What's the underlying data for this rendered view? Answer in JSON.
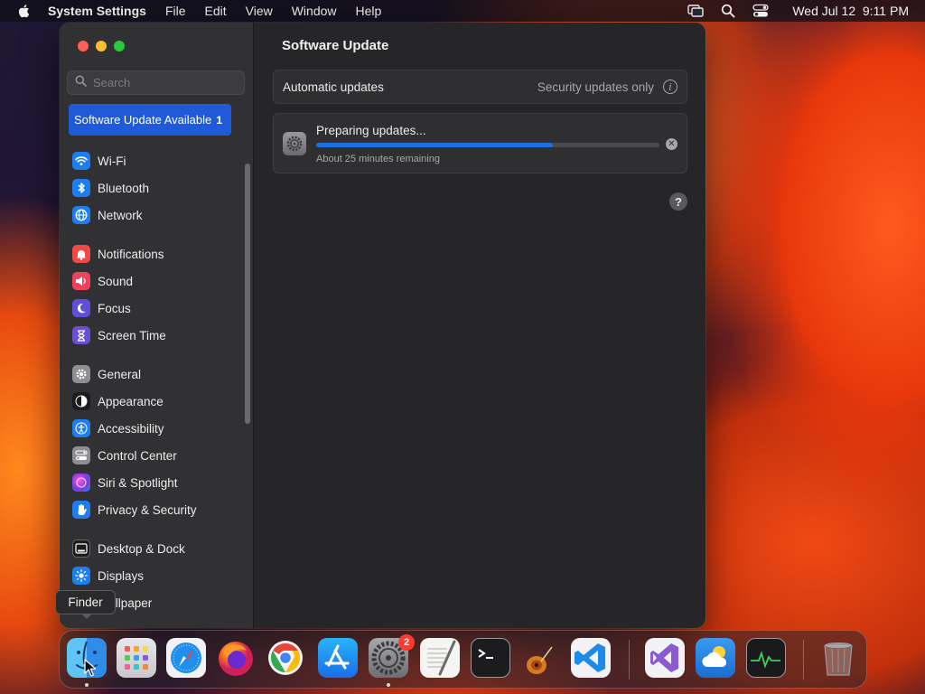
{
  "menubar": {
    "apple_icon": "apple-logo-icon",
    "app_name": "System Settings",
    "menus": [
      "File",
      "Edit",
      "View",
      "Window",
      "Help"
    ],
    "status_icons": [
      "screen-mirroring-icon",
      "spotlight-search-icon",
      "control-center-icon"
    ],
    "clock": "Wed Jul 12  9:11 PM"
  },
  "window": {
    "traffic_lights": [
      "close",
      "minimize",
      "zoom"
    ],
    "sidebar": {
      "search_placeholder": "Search",
      "update_banner": {
        "label": "Software Update Available",
        "count": "1"
      },
      "items": [
        {
          "label": "Wi-Fi",
          "icon": "wifi-icon",
          "color": "#1e7ef0"
        },
        {
          "label": "Bluetooth",
          "icon": "bluetooth-icon",
          "color": "#1e7ef0"
        },
        {
          "label": "Network",
          "icon": "globe-icon",
          "color": "#1e7ef0"
        },
        {
          "label": "Notifications",
          "icon": "bell-icon",
          "color": "#f04a46"
        },
        {
          "label": "Sound",
          "icon": "speaker-icon",
          "color": "#f0425a"
        },
        {
          "label": "Focus",
          "icon": "moon-icon",
          "color": "#5e4fd6"
        },
        {
          "label": "Screen Time",
          "icon": "hourglass-icon",
          "color": "#6a4fd6"
        },
        {
          "label": "General",
          "icon": "gear-icon",
          "color": "#8e8e93"
        },
        {
          "label": "Appearance",
          "icon": "appearance-icon",
          "color": "#1c1c1e"
        },
        {
          "label": "Accessibility",
          "icon": "accessibility-icon",
          "color": "#1e7ef0"
        },
        {
          "label": "Control Center",
          "icon": "control-center-icon",
          "color": "#8e8e93"
        },
        {
          "label": "Siri & Spotlight",
          "icon": "siri-icon",
          "color": "#c43ad8"
        },
        {
          "label": "Privacy & Security",
          "icon": "hand-icon",
          "color": "#1e7ef0"
        },
        {
          "label": "Desktop & Dock",
          "icon": "dock-icon",
          "color": "#1c1c1e"
        },
        {
          "label": "Displays",
          "icon": "sun-icon",
          "color": "#1e7ef0"
        },
        {
          "label": "Wallpaper",
          "icon": "wallpaper-icon",
          "color": "#30b0e8"
        }
      ]
    },
    "content": {
      "title": "Software Update",
      "automatic_updates": {
        "label": "Automatic updates",
        "value": "Security updates only",
        "info_icon": "info-icon"
      },
      "progress": {
        "title": "Preparing updates...",
        "subtitle": "About 25 minutes remaining",
        "fraction": 0.69,
        "icon": "system-settings-gear-icon",
        "cancel_icon": "close-circle-icon"
      },
      "help_label": "?"
    }
  },
  "tooltip": {
    "text": "Finder"
  },
  "dock": {
    "apps": [
      {
        "name": "Finder",
        "icon": "finder-icon",
        "running": true
      },
      {
        "name": "Launchpad",
        "icon": "launchpad-icon",
        "running": false
      },
      {
        "name": "Safari",
        "icon": "safari-icon",
        "running": false
      },
      {
        "name": "Firefox",
        "icon": "firefox-icon",
        "running": false
      },
      {
        "name": "Chrome",
        "icon": "chrome-icon",
        "running": false
      },
      {
        "name": "App Store",
        "icon": "app-store-icon",
        "running": false
      },
      {
        "name": "System Settings",
        "icon": "system-settings-icon",
        "running": true,
        "badge": "2"
      },
      {
        "name": "TextEdit",
        "icon": "textedit-icon",
        "running": false
      },
      {
        "name": "Terminal",
        "icon": "terminal-icon",
        "running": false
      },
      {
        "name": "GarageBand",
        "icon": "garageband-icon",
        "running": false
      },
      {
        "name": "Visual Studio Code",
        "icon": "vscode-icon",
        "running": false
      },
      {
        "name": "Visual Studio",
        "icon": "visual-studio-icon",
        "running": false
      },
      {
        "name": "Weather",
        "icon": "weather-icon",
        "running": false
      },
      {
        "name": "Activity Monitor",
        "icon": "activity-monitor-icon",
        "running": false
      },
      {
        "name": "Trash",
        "icon": "trash-icon",
        "running": false
      }
    ]
  }
}
